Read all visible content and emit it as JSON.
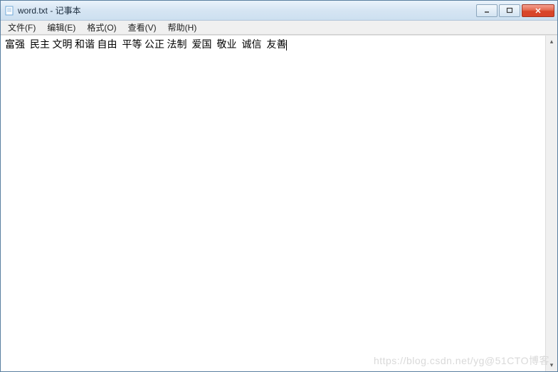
{
  "titlebar": {
    "title": "word.txt - 记事本",
    "icon_name": "notepad-icon"
  },
  "menubar": {
    "items": [
      "文件(F)",
      "编辑(E)",
      "格式(O)",
      "查看(V)",
      "帮助(H)"
    ]
  },
  "editor": {
    "content": "富强  民主 文明 和谐 自由  平等 公正 法制  爱国  敬业  诚信  友善"
  },
  "watermark": "https://blog.csdn.net/yg@51CTO博客"
}
